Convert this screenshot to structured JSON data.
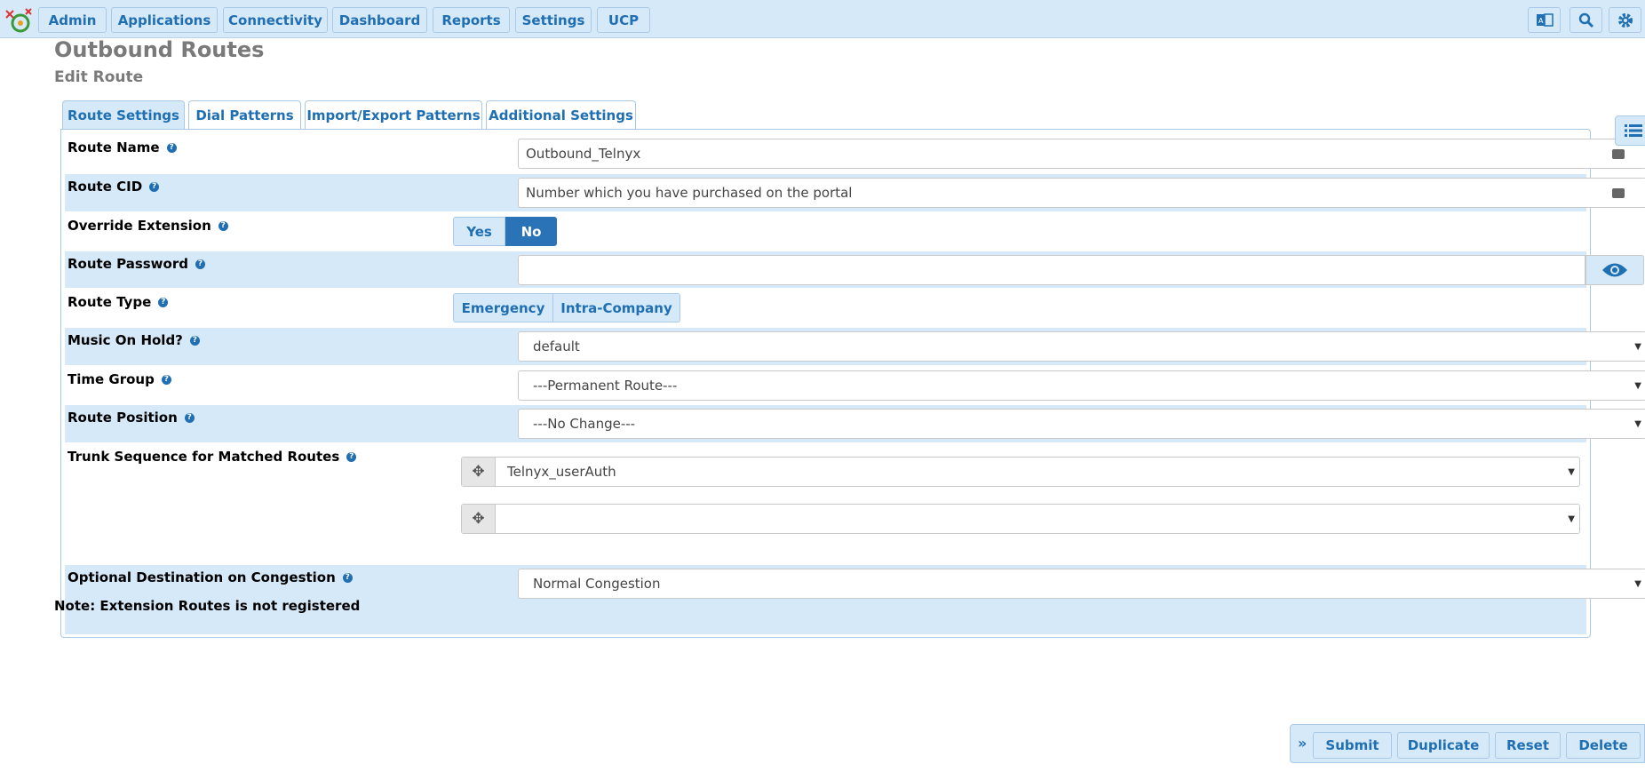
{
  "nav": {
    "items": [
      "Admin",
      "Applications",
      "Connectivity",
      "Dashboard",
      "Reports",
      "Settings",
      "UCP"
    ]
  },
  "page": {
    "title": "Outbound Routes",
    "subtitle": "Edit Route"
  },
  "tabs": [
    "Route Settings",
    "Dial Patterns",
    "Import/Export Patterns",
    "Additional Settings"
  ],
  "form": {
    "route_name": {
      "label": "Route Name",
      "value": "Outbound_Telnyx"
    },
    "route_cid": {
      "label": "Route CID",
      "placeholder": "Number which you have purchased on the portal"
    },
    "override_extension": {
      "label": "Override Extension",
      "yes": "Yes",
      "no": "No",
      "selected": "No"
    },
    "route_password": {
      "label": "Route Password",
      "value": ""
    },
    "route_type": {
      "label": "Route Type",
      "emergency": "Emergency",
      "intra_company": "Intra-Company"
    },
    "music_on_hold": {
      "label": "Music On Hold?",
      "value": "default"
    },
    "time_group": {
      "label": "Time Group",
      "value": "---Permanent Route---"
    },
    "route_position": {
      "label": "Route Position",
      "value": "---No Change---"
    },
    "trunk_sequence": {
      "label": "Trunk Sequence for Matched Routes",
      "trunks": [
        "Telnyx_userAuth",
        ""
      ]
    },
    "congestion": {
      "label": "Optional Destination on Congestion",
      "value": "Normal Congestion"
    },
    "note": "Note: Extension Routes is not registered"
  },
  "actions": {
    "submit": "Submit",
    "duplicate": "Duplicate",
    "reset": "Reset",
    "delete": "Delete"
  },
  "colors": {
    "accent": "#1f6fb2",
    "bar": "#d6e9f8",
    "toggle_on": "#2a73b7"
  }
}
